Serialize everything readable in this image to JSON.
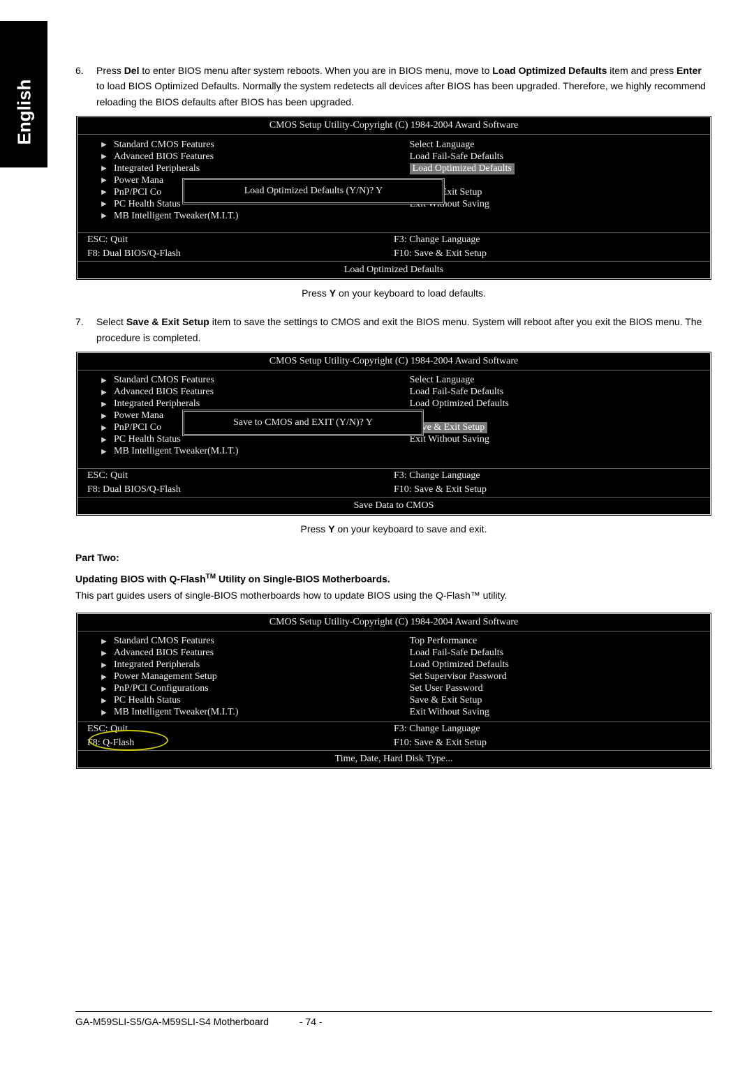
{
  "sidebar": {
    "language": "English"
  },
  "steps": {
    "s6": {
      "num": "6.",
      "text_parts": {
        "a": "Press ",
        "b": "Del",
        "c": " to enter BIOS menu after system reboots. When you are in BIOS menu, move to ",
        "d": "Load Optimized Defaults",
        "e": " item and press ",
        "f": "Enter",
        "g": " to load BIOS Optimized Defaults. Normally the system redetects all devices after BIOS has been upgraded. Therefore, we highly recommend reloading the BIOS defaults after BIOS has been upgraded."
      }
    },
    "s7": {
      "num": "7.",
      "text_parts": {
        "a": "Select ",
        "b": "Save & Exit Setup",
        "c": " item to save the settings to CMOS and exit the BIOS menu. System will reboot after you exit the BIOS menu. The procedure is completed."
      }
    }
  },
  "bios_common": {
    "title": "CMOS Setup Utility-Copyright (C) 1984-2004 Award Software",
    "left_items": [
      "Standard CMOS Features",
      "Advanced BIOS Features",
      "Integrated Peripherals",
      "Power Management Setup",
      "PnP/PCI Configurations",
      "PC Health Status",
      "MB Intelligent Tweaker(M.I.T.)"
    ],
    "left_items_trunc": {
      "power": "Power Mana",
      "pnp": "PnP/PCI Co"
    },
    "hints": {
      "esc": "ESC: Quit",
      "f3": "F3: Change Language",
      "f8dual": "F8: Dual BIOS/Q-Flash",
      "f8": "F8: Q-Flash",
      "f10": "F10: Save & Exit Setup"
    }
  },
  "bios1": {
    "right_items": [
      "Select Language",
      "Load Fail-Safe Defaults",
      "Load Optimized Defaults",
      "",
      "Save & Exit Setup",
      "Exit Without Saving"
    ],
    "selected": "Load Optimized Defaults",
    "dialog": "Load Optimized Defaults (Y/N)? Y",
    "status": "Load Optimized Defaults",
    "caption_parts": {
      "a": "Press ",
      "b": "Y",
      "c": " on your keyboard to load defaults."
    }
  },
  "bios2": {
    "right_items": [
      "Select Language",
      "Load Fail-Safe Defaults",
      "Load Optimized Defaults",
      "",
      "Save & Exit Setup",
      "Exit Without Saving"
    ],
    "selected": "Save & Exit Setup",
    "dialog": "Save to CMOS and EXIT (Y/N)? Y",
    "status": "Save Data to CMOS",
    "caption_parts": {
      "a": "Press ",
      "b": "Y",
      "c": " on your keyboard to save and exit."
    }
  },
  "part_two": {
    "heading": "Part Two:",
    "subheading_parts": {
      "a": "Updating BIOS with Q-Flash",
      "b": "TM",
      "c": " Utility on Single-BIOS Motherboards."
    },
    "body": "This part guides users of single-BIOS motherboards how to update BIOS using the Q-Flash™ utility."
  },
  "bios3": {
    "right_items": [
      "Top Performance",
      "Load Fail-Safe Defaults",
      "Load Optimized Defaults",
      "Set Supervisor Password",
      "Set User Password",
      "Save & Exit Setup",
      "Exit Without Saving"
    ],
    "status": "Time, Date, Hard Disk Type..."
  },
  "footer": {
    "model": "GA-M59SLI-S5/GA-M59SLI-S4 Motherboard",
    "page": "- 74 -"
  }
}
